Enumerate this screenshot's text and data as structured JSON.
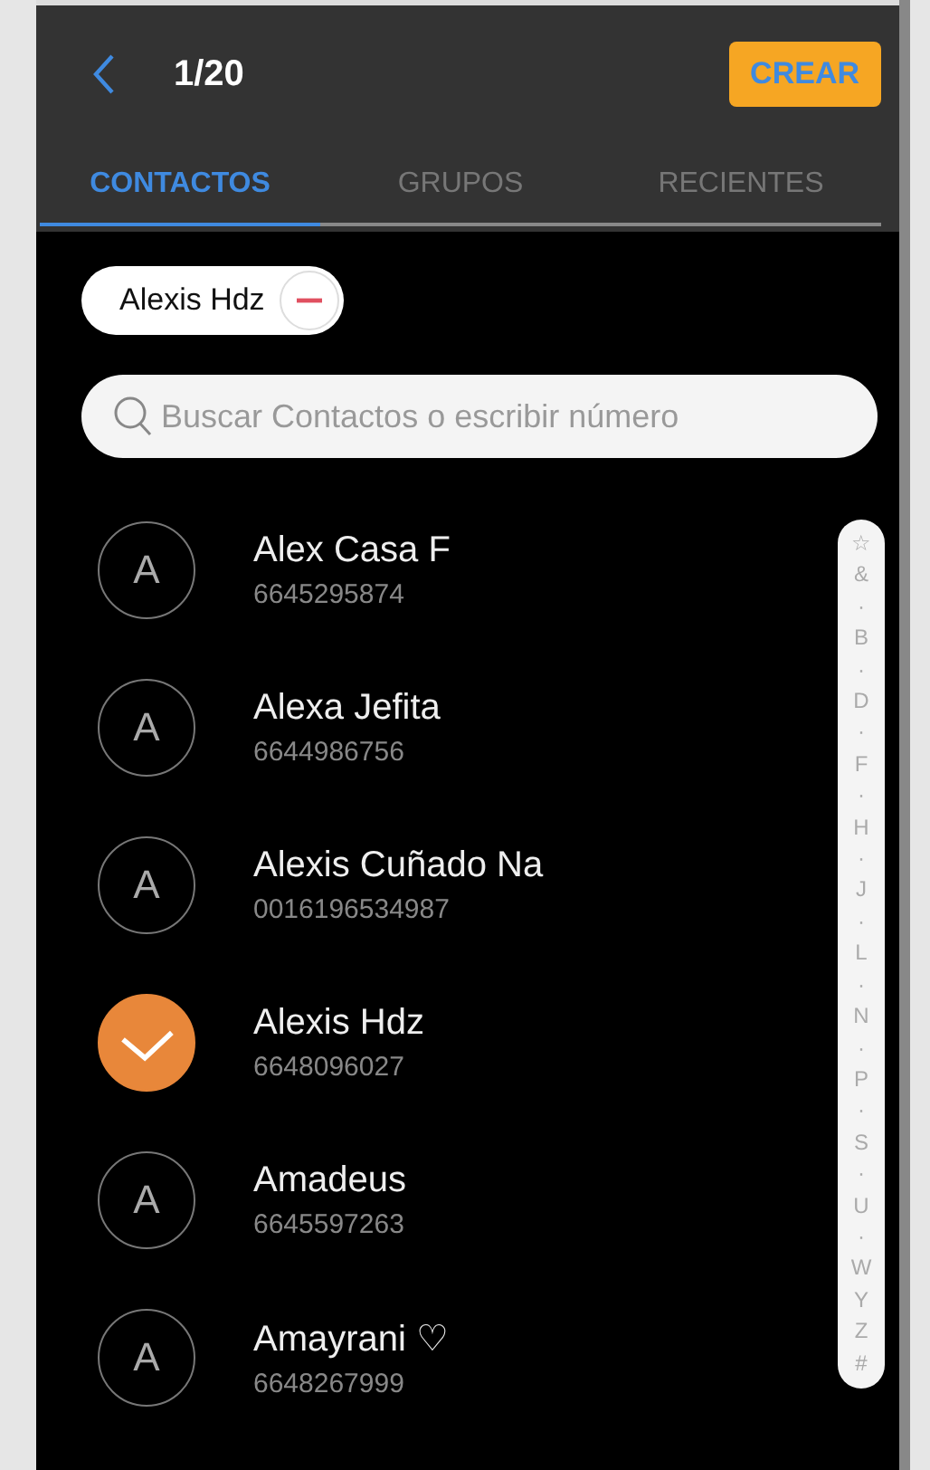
{
  "header": {
    "count": "1/20",
    "create_button": "CREAR"
  },
  "tabs": [
    {
      "label": "CONTACTOS",
      "selected": true
    },
    {
      "label": "GRUPOS",
      "selected": false
    },
    {
      "label": "RECIENTES",
      "selected": false
    }
  ],
  "chips": [
    {
      "label": "Alexis Hdz"
    }
  ],
  "search": {
    "placeholder": "Buscar Contactos o escribir número"
  },
  "contacts": [
    {
      "initial": "A",
      "name": "Alex Casa F",
      "phone": "6645295874",
      "selected": false
    },
    {
      "initial": "A",
      "name": "Alexa Jefita",
      "phone": "6644986756",
      "selected": false
    },
    {
      "initial": "A",
      "name": "Alexis Cuñado Na",
      "phone": "0016196534987",
      "selected": false
    },
    {
      "name": "Alexis Hdz",
      "phone": "6648096027",
      "selected": true
    },
    {
      "initial": "A",
      "name": "Amadeus",
      "phone": "6645597263",
      "selected": false
    },
    {
      "initial": "A",
      "name": "Amayrani ♡",
      "phone": "6648267999",
      "selected": false
    }
  ],
  "index": [
    "☆",
    "&",
    "·",
    "B",
    "·",
    "D",
    "·",
    "F",
    "·",
    "H",
    "·",
    "J",
    "·",
    "L",
    "·",
    "N",
    "·",
    "P",
    "·",
    "S",
    "·",
    "U",
    "·",
    "W",
    "Y",
    "Z",
    "#"
  ]
}
